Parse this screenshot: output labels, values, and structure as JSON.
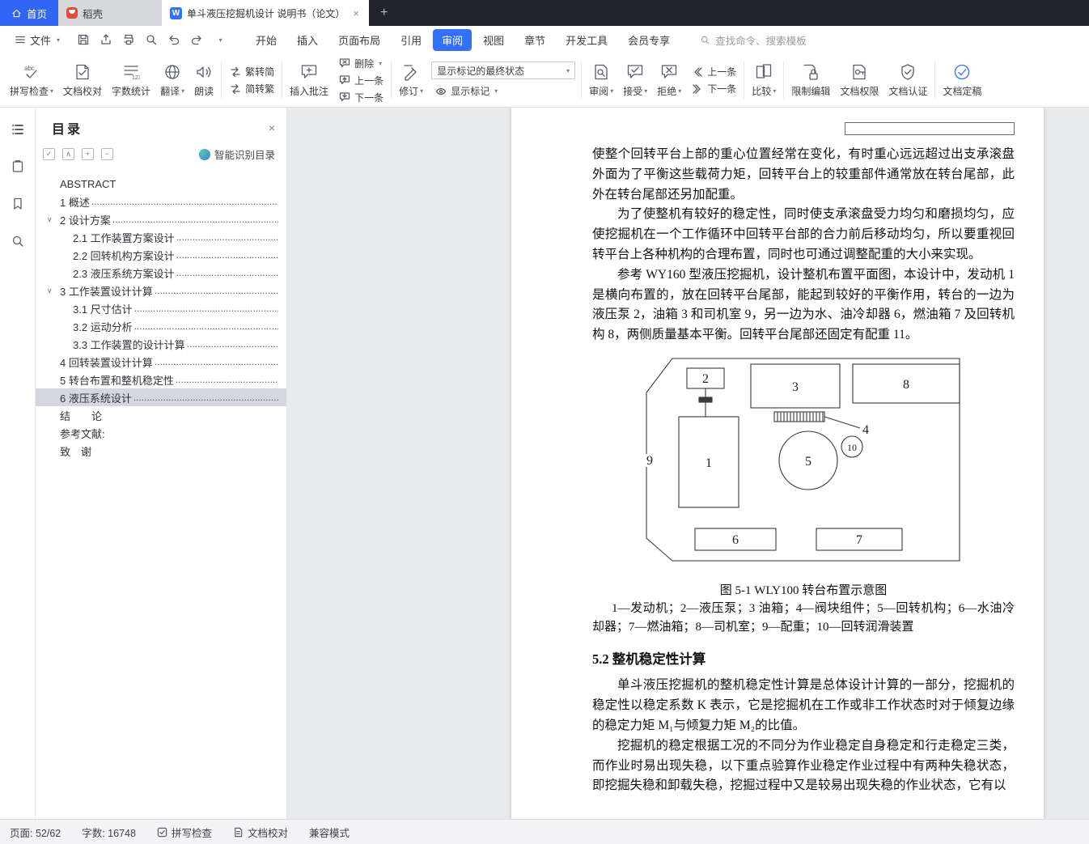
{
  "colors": {
    "accent": "#3370ff",
    "titlebar_bg": "#22232a",
    "docer_red": "#e8483c",
    "toc_selected_bg": "#d5d7dc",
    "canvas_bg": "#e9eaec"
  },
  "icons": {
    "dropdown": "▾",
    "chevron_expanded": "∨",
    "close": "×",
    "plus": "+",
    "search_hint_icon": "⌕"
  },
  "titlebar": {
    "home_tab": "首页",
    "docer_tab": "稻壳",
    "doc_tab_title": "单斗液压挖掘机设计 说明书（论文）",
    "doc_tab_icon": "W"
  },
  "menubar": {
    "file_label": "文件",
    "tabs": [
      {
        "label": "开始"
      },
      {
        "label": "插入"
      },
      {
        "label": "页面布局"
      },
      {
        "label": "引用"
      },
      {
        "label": "审阅"
      },
      {
        "label": "视图"
      },
      {
        "label": "章节"
      },
      {
        "label": "开发工具"
      },
      {
        "label": "会员专享"
      }
    ],
    "active_tab": "审阅",
    "search_placeholder": "查找命令、搜索模板"
  },
  "ribbon": {
    "spell_check": "拼写检查",
    "doc_proof": "文档校对",
    "word_count": "字数统计",
    "translate": "翻译",
    "read_aloud": "朗读",
    "trad_to_simp": "繁转简",
    "simp_to_trad": "简转繁",
    "insert_comment": "插入批注",
    "delete": "删除",
    "prev_one_a": "上一条",
    "next_one_a": "下一条",
    "track_changes": "修订",
    "markup_state": "显示标记的最终状态",
    "show_markup": "显示标记",
    "review": "审阅",
    "accept": "接受",
    "reject": "拒绝",
    "prev_one_b": "上一条",
    "next_one_b": "下一条",
    "compare": "比较",
    "restrict_edit": "限制编辑",
    "doc_permission": "文档权限",
    "doc_auth": "文档认证",
    "doc_finalize": "文档定稿"
  },
  "toc_panel": {
    "title": "目录",
    "smart_recognize_label": "智能识别目录",
    "tools": {
      "t1": "✓",
      "t2": "∧",
      "t3": "+",
      "t4": "−"
    },
    "items": [
      {
        "label": "ABSTRACT"
      },
      {
        "label": "1 概述"
      },
      {
        "label": "2 设计方案"
      },
      {
        "label": "2.1 工作装置方案设计"
      },
      {
        "label": "2.2 回转机构方案设计"
      },
      {
        "label": "2.3 液压系统方案设计"
      },
      {
        "label": "3 工作装置设计计算"
      },
      {
        "label": "3.1 尺寸估计"
      },
      {
        "label": "3.2 运动分析"
      },
      {
        "label": "3.3 工作装置的设计计算"
      },
      {
        "label": "4 回转装置设计计算"
      },
      {
        "label": "5 转台布置和整机稳定性"
      },
      {
        "label": "6 液压系统设计"
      },
      {
        "label": "结　　论"
      },
      {
        "label": "参考文献:"
      },
      {
        "label": "致　谢"
      }
    ],
    "selected_item": "6 液压系统设计"
  },
  "document": {
    "p1": "使整个回转平台上部的重心位置经常在变化，有时重心远远超过出支承滚盘外面为了平衡这些载荷力矩，回转平台上的较重部件通常放在转台尾部，此外在转台尾部还另加配重。",
    "p2": "为了使整机有较好的稳定性，同时使支承滚盘受力均匀和磨损均匀，应使挖掘机在一个工作循环中回转平台部的合力前后移动均匀，所以要重视回转平台上各种机构的合理布置，同时也可通过调整配重的大小来实现。",
    "p3": "参考 WY160 型液压挖掘机，设计整机布置平面图，本设计中，发动机 1 是横向布置的，放在回转平台尾部，能起到较好的平衡作用，转台的一边为液压泵 2，油箱 3 和司机室 9，另一边为水、油冷却器 6，燃油箱 7 及回转机构 8，两侧质量基本平衡。回转平台尾部还固定有配重 11。",
    "figure": {
      "caption": "图 5-1 WLY100 转台布置示意图",
      "legend": "1—发动机；2—液压泵；3 油箱；4—阀块组件；5—回转机构；6—水油冷却器；7—燃油箱；8—司机室；9—配重；10—回转润滑装置",
      "n1": "1",
      "n2": "2",
      "n3": "3",
      "n4": "4",
      "n5": "5",
      "n6": "6",
      "n7": "7",
      "n8": "8",
      "n9": "9",
      "n10": "10"
    },
    "heading_5_2": "5.2 整机稳定性计算",
    "p4": "单斗液压挖掘机的整机稳定性计算是总体设计计算的一部分，挖掘机的稳定性以稳定系数 K 表示，它是挖掘机在工作或非工作状态时对于倾复边缘的稳定力矩 M₁与倾复力矩 M₂的比值。",
    "p5": "挖掘机的稳定根据工况的不同分为作业稳定自身稳定和行走稳定三类，而作业时易出现失稳，以下重点验算作业稳定作业过程中有两种失稳状态，即挖掘失稳和卸载失稳，挖掘过程中又是较易出现失稳的作业状态，它有以"
  },
  "statusbar": {
    "page_label": "页面: 52/62",
    "word_count_label": "字数: 16748",
    "spell_check_label": "拼写检查",
    "doc_proof_label": "文档校对",
    "compat_label": "兼容模式"
  }
}
